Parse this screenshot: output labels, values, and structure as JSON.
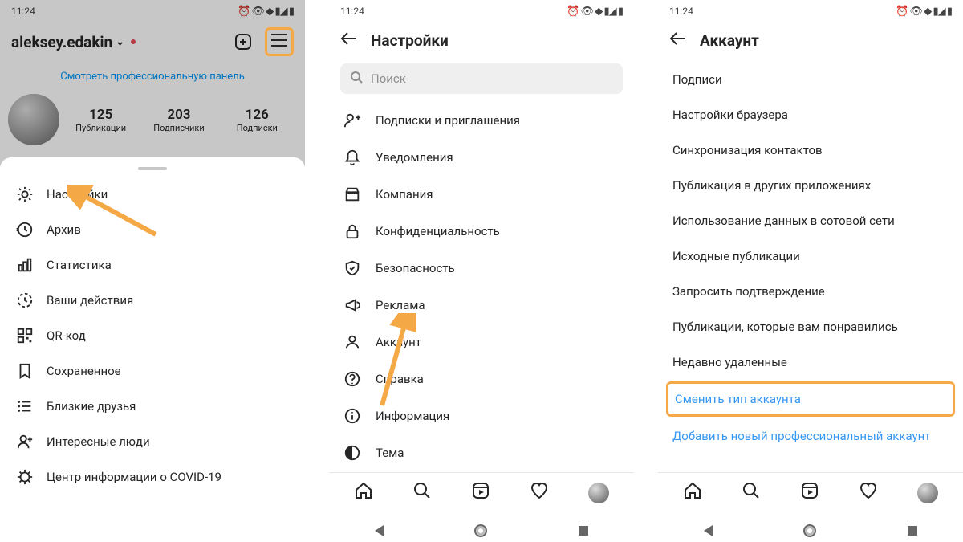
{
  "time": "11:24",
  "highlight_color": "#f5a946",
  "link_color": "#3897f0",
  "phone1": {
    "username": "aleksey.edakin",
    "panel_link": "Смотреть профессиональную панель",
    "stats": [
      {
        "num": "125",
        "lbl": "Публикации"
      },
      {
        "num": "203",
        "lbl": "Подписчики"
      },
      {
        "num": "126",
        "lbl": "Подписки"
      }
    ],
    "menu": [
      {
        "icon": "gear",
        "label": "Настройки"
      },
      {
        "icon": "history",
        "label": "Архив"
      },
      {
        "icon": "stats",
        "label": "Статистика"
      },
      {
        "icon": "activity",
        "label": "Ваши действия"
      },
      {
        "icon": "qr",
        "label": "QR-код"
      },
      {
        "icon": "bookmark",
        "label": "Сохраненное"
      },
      {
        "icon": "list",
        "label": "Близкие друзья"
      },
      {
        "icon": "person-add",
        "label": "Интересные люди"
      },
      {
        "icon": "covid",
        "label": "Центр информации о COVID-19"
      }
    ]
  },
  "phone2": {
    "title": "Настройки",
    "search_placeholder": "Поиск",
    "rows": [
      {
        "icon": "follow",
        "label": "Подписки и приглашения"
      },
      {
        "icon": "bell",
        "label": "Уведомления"
      },
      {
        "icon": "shop",
        "label": "Компания"
      },
      {
        "icon": "lock",
        "label": "Конфиденциальность"
      },
      {
        "icon": "shield",
        "label": "Безопасность"
      },
      {
        "icon": "ads",
        "label": "Реклама"
      },
      {
        "icon": "account",
        "label": "Аккаунт"
      },
      {
        "icon": "help",
        "label": "Справка"
      },
      {
        "icon": "info",
        "label": "Информация"
      },
      {
        "icon": "theme",
        "label": "Тема"
      }
    ]
  },
  "phone3": {
    "title": "Аккаунт",
    "rows": [
      "Подписи",
      "Настройки браузера",
      "Синхронизация контактов",
      "Публикация в других приложениях",
      "Использование данных в сотовой сети",
      "Исходные публикации",
      "Запросить подтверждение",
      "Публикации, которые вам понравились",
      "Недавно удаленные"
    ],
    "highlight": "Сменить тип аккаунта",
    "extra_link": "Добавить новый профессиональный аккаунт"
  }
}
